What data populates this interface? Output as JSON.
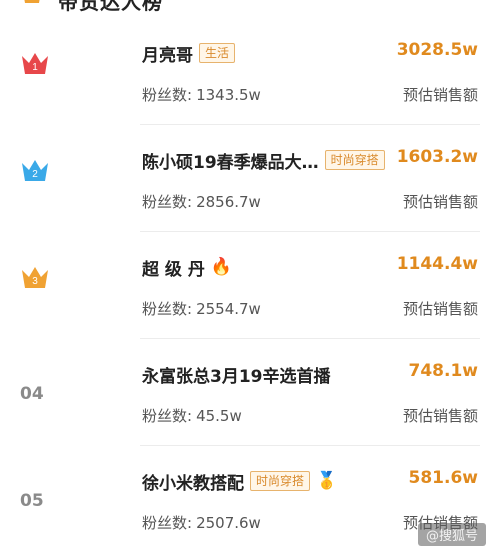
{
  "header": {
    "title": "带货达人榜",
    "more": "﹀"
  },
  "rows": [
    {
      "rank": "1",
      "crown_color": "#e7474a",
      "name": "月亮哥",
      "tag": "生活",
      "emoji": "",
      "fans_label": "粉丝数:",
      "fans": "1343.5w",
      "sales": "3028.5w",
      "sales_label": "预估销售额"
    },
    {
      "rank": "2",
      "crown_color": "#3aa9e8",
      "name": "陈小硕19春季爆品大…",
      "tag": "时尚穿搭",
      "emoji": "",
      "fans_label": "粉丝数:",
      "fans": "2856.7w",
      "sales": "1603.2w",
      "sales_label": "预估销售额"
    },
    {
      "rank": "3",
      "crown_color": "#f0a233",
      "name": "超 级 丹",
      "tag": "",
      "emoji": "🔥",
      "fans_label": "粉丝数:",
      "fans": "2554.7w",
      "sales": "1144.4w",
      "sales_label": "预估销售额"
    },
    {
      "rank": "04",
      "crown_color": "",
      "name": "永富张总3月19辛选首播",
      "tag": "",
      "emoji": "",
      "fans_label": "粉丝数:",
      "fans": "45.5w",
      "sales": "748.1w",
      "sales_label": "预估销售额"
    },
    {
      "rank": "05",
      "crown_color": "",
      "name": "徐小米教搭配",
      "tag": "时尚穿搭",
      "emoji": "🥇",
      "fans_label": "粉丝数:",
      "fans": "2507.6w",
      "sales": "581.6w",
      "sales_label": "预估销售额"
    }
  ],
  "watermark": "@搜狐号"
}
